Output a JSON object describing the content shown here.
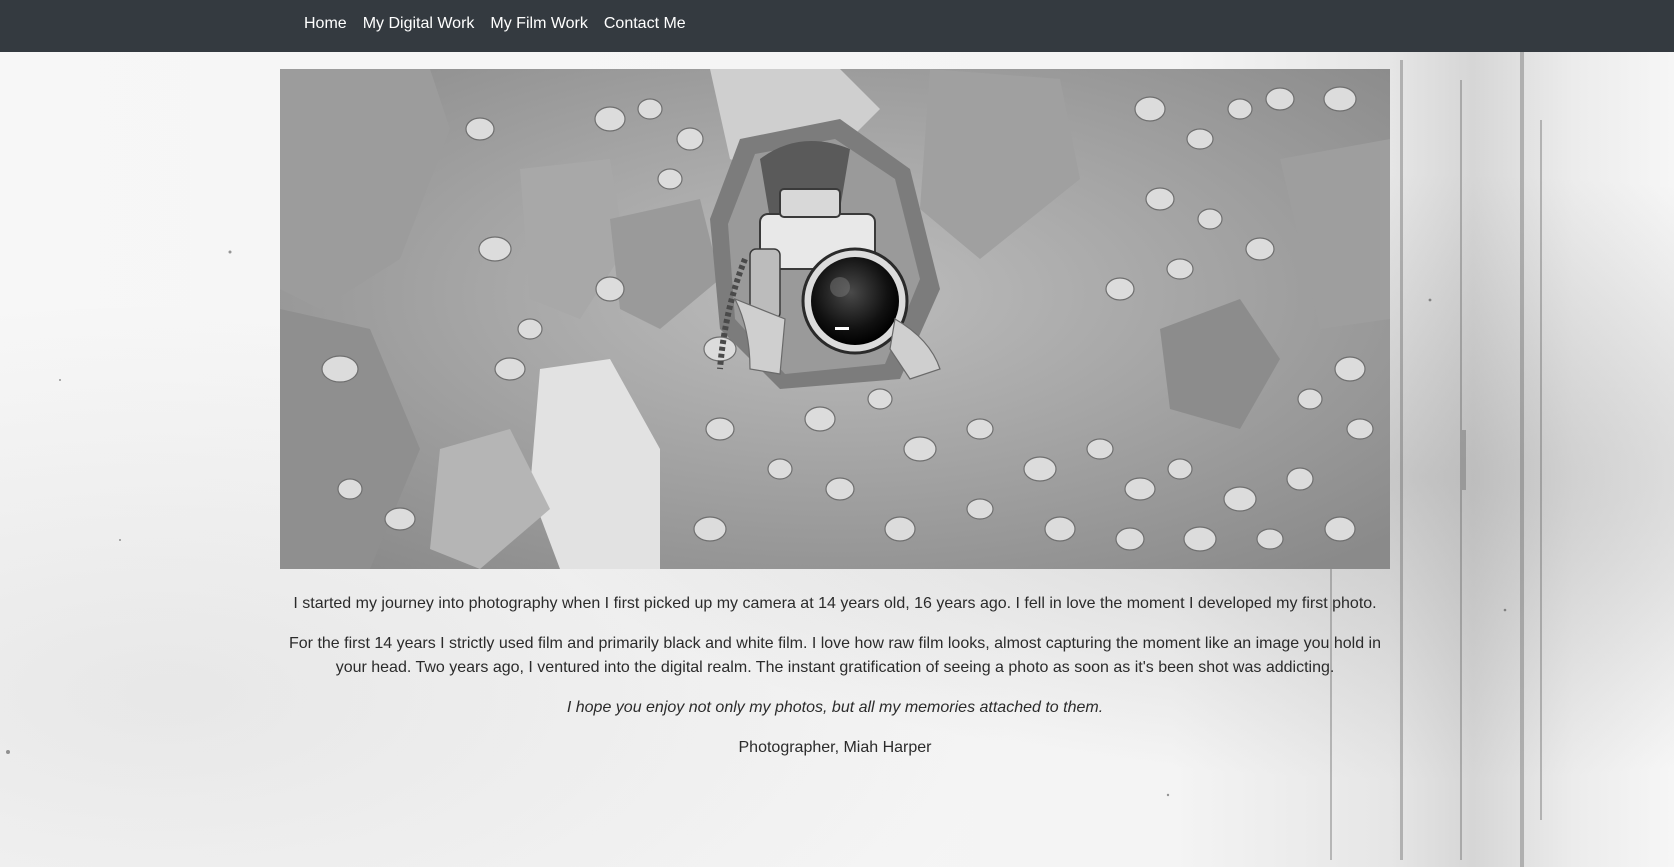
{
  "nav": {
    "items": [
      "Home",
      "My Digital Work",
      "My Film Work",
      "Contact Me"
    ]
  },
  "hero": {
    "image_description_icon": "photographer-with-camera-photo"
  },
  "content": {
    "paragraph1": "I started my journey into photography when I first picked up my camera at 14 years old, 16 years ago. I fell in love the moment I developed my first photo.",
    "paragraph2": "For the first 14 years I strictly used film and primarily black and white film. I love how raw film looks, almost capturing the moment like an image you hold in your head. Two years ago, I ventured into the digital realm. The instant gratification of seeing a photo as soon as it's been shot was addicting.",
    "quote": "I hope you enjoy not only my photos, but all my memories attached to them.",
    "signature": "Photographer, Miah Harper"
  },
  "colors": {
    "navbar": "#343a40",
    "nav_text": "#ffffff",
    "body_text": "#2b2b2b"
  }
}
